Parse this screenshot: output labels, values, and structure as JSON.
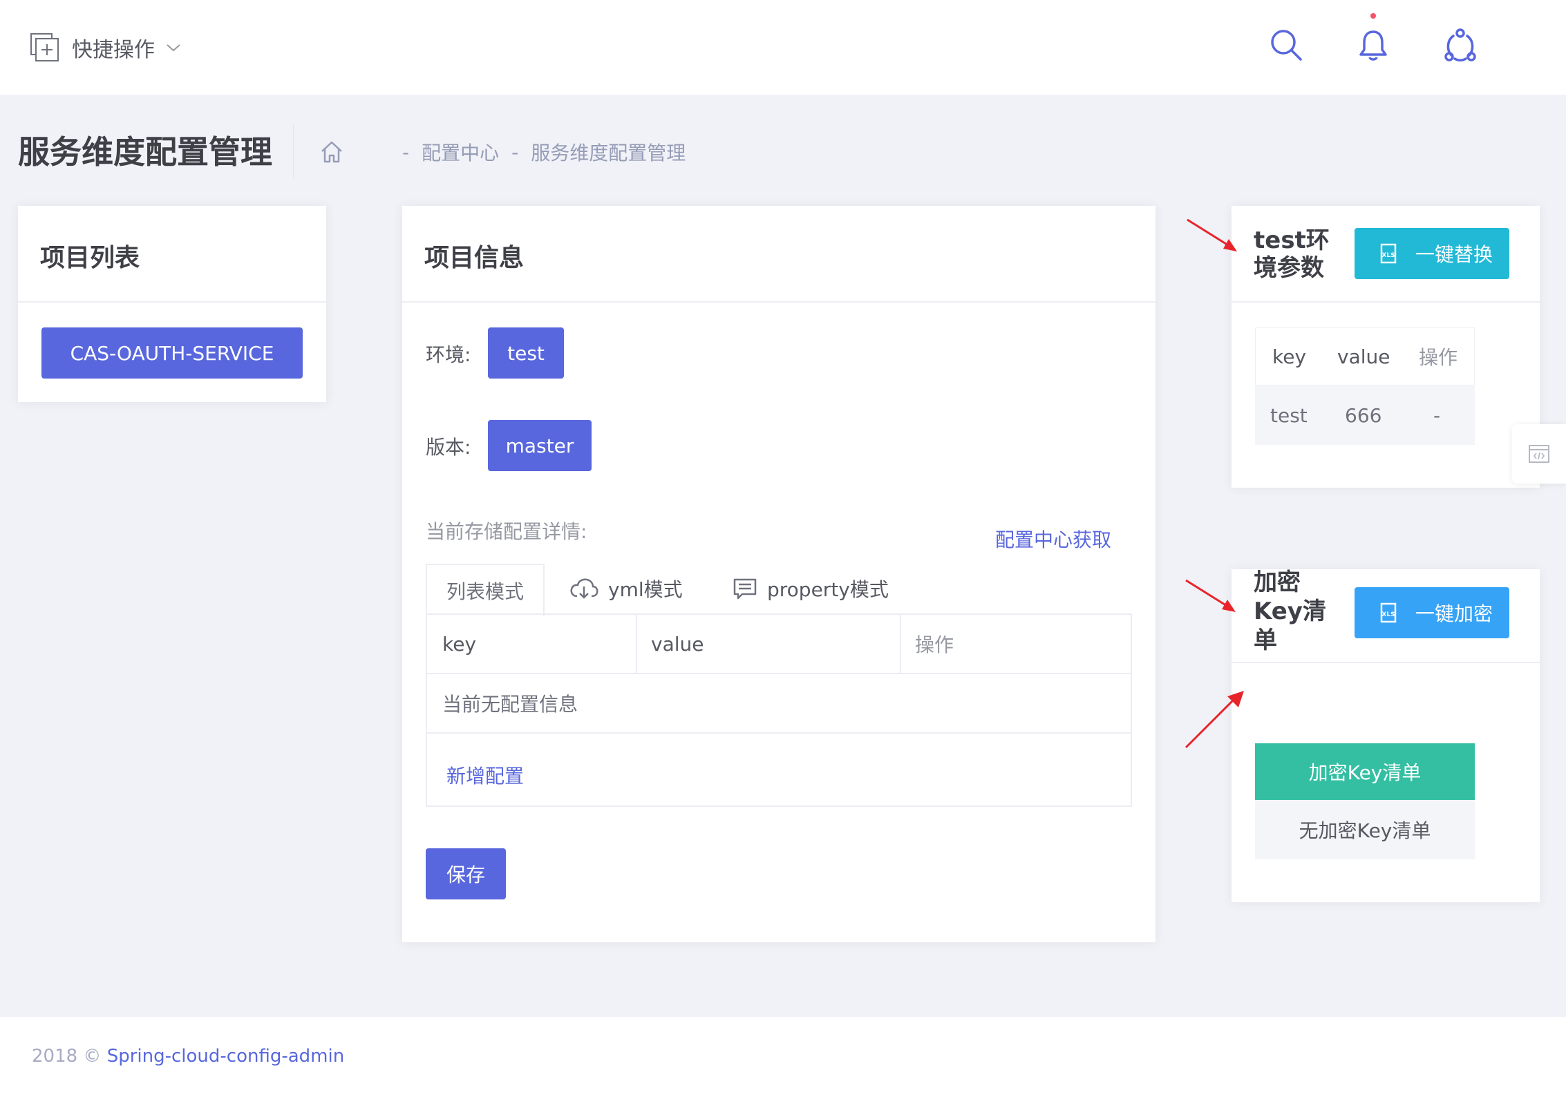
{
  "topbar": {
    "quick_actions_label": "快捷操作",
    "icons": [
      "quick-add-icon",
      "chevron-down-icon",
      "search-icon",
      "bell-icon",
      "user-network-icon"
    ]
  },
  "subheader": {
    "page_title": "服务维度配置管理",
    "breadcrumb": [
      "配置中心",
      "服务维度配置管理"
    ]
  },
  "project_list": {
    "title": "项目列表",
    "items": [
      "CAS-OAUTH-SERVICE"
    ]
  },
  "project_info": {
    "title": "项目信息",
    "env_label": "环境:",
    "env_value": "test",
    "version_label": "版本:",
    "version_value": "master",
    "storage_label": "当前存储配置详情:",
    "fetch_link": "配置中心获取",
    "tabs": [
      "列表模式",
      "yml模式",
      "property模式"
    ],
    "table_headers": [
      "key",
      "value",
      "操作"
    ],
    "empty_text": "当前无配置信息",
    "add_link": "新增配置",
    "save_button": "保存"
  },
  "env_params": {
    "title": "test环境参数",
    "action_button": "一键替换",
    "headers": [
      "key",
      "value",
      "操作"
    ],
    "rows": [
      [
        "test",
        "666",
        "-"
      ]
    ]
  },
  "encrypt_keys": {
    "title": "加密Key清单",
    "action_button": "一键加密",
    "list": [
      "加密Key清单",
      "无加密Key清单"
    ]
  },
  "footer": {
    "prefix": "2018 ©",
    "link": "Spring-cloud-config-admin"
  },
  "colors": {
    "primary": "#5867dd",
    "info": "#22b9d6",
    "brand_blue": "#36a3f7",
    "success": "#34bfa3",
    "annotation_arrow": "#e8242b"
  }
}
